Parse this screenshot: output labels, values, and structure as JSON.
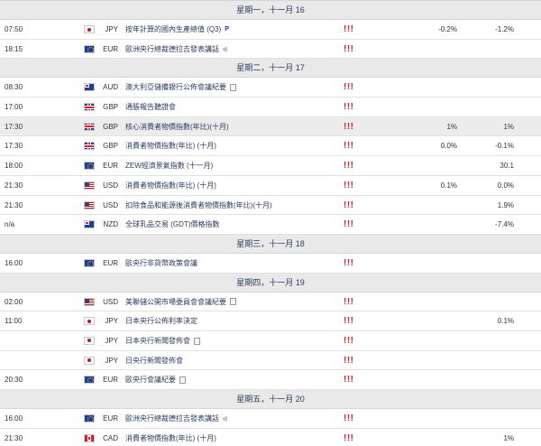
{
  "days": [
    {
      "label": "星期一，十一月 16",
      "events": [
        {
          "time": "07:50",
          "flag": "jp",
          "currency": "JPY",
          "title": "按年計算的國內生產總值 (Q3)",
          "icon": "preliminary-icon",
          "icon_text": "P",
          "importance": "!!!",
          "actual": "",
          "forecast": "-0.2%",
          "previous": "-1.2%",
          "highlight": false
        },
        {
          "time": "18:15",
          "flag": "eu",
          "currency": "EUR",
          "title": "歐洲央行總裁德拉吉發表講話",
          "icon": "speech-icon",
          "icon_text": "",
          "importance": "!!!",
          "actual": "",
          "forecast": "",
          "previous": "",
          "highlight": false
        }
      ]
    },
    {
      "label": "星期二，十一月 17",
      "events": [
        {
          "time": "08:30",
          "flag": "au",
          "currency": "AUD",
          "title": "澳大利亞儲備銀行公佈會議紀要",
          "icon": "report-icon",
          "icon_text": "",
          "importance": "!!!",
          "actual": "",
          "forecast": "",
          "previous": "",
          "highlight": false
        },
        {
          "time": "17:00",
          "flag": "gb",
          "currency": "GBP",
          "title": "通脹報告聽證會",
          "icon": "",
          "icon_text": "",
          "importance": "!!!",
          "actual": "",
          "forecast": "",
          "previous": "",
          "highlight": false
        },
        {
          "time": "17:30",
          "flag": "gb",
          "currency": "GBP",
          "title": "核心消費者物價指數(年比)(十月)",
          "icon": "",
          "icon_text": "",
          "importance": "!!!",
          "actual": "1%",
          "forecast": "",
          "previous": "1%",
          "highlight": true
        },
        {
          "time": "17:30",
          "flag": "gb",
          "currency": "GBP",
          "title": "消費者物價指數(年比) (十月)",
          "icon": "",
          "icon_text": "",
          "importance": "!!!",
          "actual": "0.0%",
          "forecast": "",
          "previous": "-0.1%",
          "highlight": false
        },
        {
          "time": "18:00",
          "flag": "eu",
          "currency": "EUR",
          "title": "ZEW經濟景氣指數 (十一月)",
          "icon": "",
          "icon_text": "",
          "importance": "!!!",
          "actual": "",
          "forecast": "",
          "previous": "30.1",
          "highlight": false
        },
        {
          "time": "21:30",
          "flag": "us",
          "currency": "USD",
          "title": "消費者物價指數(年比) (十月)",
          "icon": "",
          "icon_text": "",
          "importance": "!!!",
          "actual": "0.1%",
          "forecast": "",
          "previous": "0.0%",
          "highlight": false
        },
        {
          "time": "21:30",
          "flag": "us",
          "currency": "USD",
          "title": "扣除食品和能源後消費者物價指數(年比)(十月)",
          "icon": "",
          "icon_text": "",
          "importance": "!!!",
          "actual": "",
          "forecast": "",
          "previous": "1.9%",
          "highlight": false
        },
        {
          "time": "n/a",
          "flag": "nz",
          "currency": "NZD",
          "title": "全球乳品交易 (GDT)價格指數",
          "icon": "",
          "icon_text": "",
          "importance": "!!!",
          "actual": "",
          "forecast": "",
          "previous": "-7.4%",
          "highlight": false
        }
      ]
    },
    {
      "label": "星期三，十一月 18",
      "events": [
        {
          "time": "16:00",
          "flag": "eu",
          "currency": "EUR",
          "title": "歐央行非貨幣政策會議",
          "icon": "",
          "icon_text": "",
          "importance": "!!!",
          "actual": "",
          "forecast": "",
          "previous": "",
          "highlight": false
        }
      ]
    },
    {
      "label": "星期四，十一月 19",
      "events": [
        {
          "time": "02:00",
          "flag": "us",
          "currency": "USD",
          "title": "美聯儲公開市場委員會會議紀要",
          "icon": "report-icon",
          "icon_text": "",
          "importance": "!!!",
          "actual": "",
          "forecast": "",
          "previous": "",
          "highlight": false
        },
        {
          "time": "11:00",
          "flag": "jp",
          "currency": "JPY",
          "title": "日本央行公佈利率決定",
          "icon": "",
          "icon_text": "",
          "importance": "!!!",
          "actual": "",
          "forecast": "",
          "previous": "0.1%",
          "highlight": false
        },
        {
          "time": "",
          "flag": "jp",
          "currency": "JPY",
          "title": "日本央行新聞發佈會",
          "icon": "report-icon",
          "icon_text": "",
          "importance": "!!!",
          "actual": "",
          "forecast": "",
          "previous": "",
          "highlight": false
        },
        {
          "time": "",
          "flag": "jp",
          "currency": "JPY",
          "title": "日央行新聞發佈會",
          "icon": "",
          "icon_text": "",
          "importance": "!!!",
          "actual": "",
          "forecast": "",
          "previous": "",
          "highlight": false
        },
        {
          "time": "20:30",
          "flag": "eu",
          "currency": "EUR",
          "title": "歐央行會議紀要",
          "icon": "report-icon",
          "icon_text": "",
          "importance": "!!!",
          "actual": "",
          "forecast": "",
          "previous": "",
          "highlight": false
        }
      ]
    },
    {
      "label": "星期五，十一月 20",
      "events": [
        {
          "time": "16:00",
          "flag": "eu",
          "currency": "EUR",
          "title": "歐洲央行總裁德拉吉發表講話",
          "icon": "speech-icon",
          "icon_text": "",
          "importance": "!!!",
          "actual": "",
          "forecast": "",
          "previous": "",
          "highlight": false
        },
        {
          "time": "21:30",
          "flag": "ca",
          "currency": "CAD",
          "title": "消費者物價指數(年比) (十月)",
          "icon": "",
          "icon_text": "",
          "importance": "!!!",
          "actual": "",
          "forecast": "",
          "previous": "1%",
          "highlight": false
        },
        {
          "time": "21:30",
          "flag": "ca",
          "currency": "CAD",
          "title": "加拿大央行核心消費者物價指數(年比)(十月)",
          "icon": "",
          "icon_text": "",
          "importance": "!!!",
          "actual": "",
          "forecast": "",
          "previous": "2.1%",
          "highlight": false
        }
      ]
    }
  ],
  "colors": {
    "importance": "#d1202f",
    "day_header_bg": "#e9e9e9",
    "highlight_row_bg": "#ececec",
    "title_text": "#2d3b5a"
  }
}
